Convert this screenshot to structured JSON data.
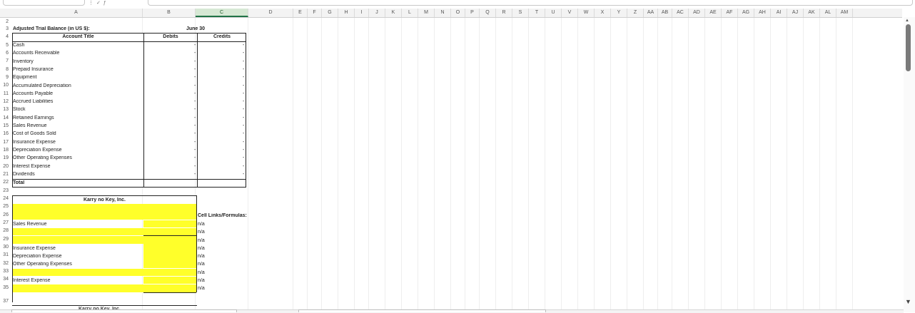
{
  "columns": [
    "A",
    "B",
    "C",
    "D",
    "E",
    "F",
    "G",
    "H",
    "I",
    "J",
    "K",
    "L",
    "M",
    "N",
    "O",
    "P",
    "Q",
    "R",
    "S",
    "T",
    "U",
    "V",
    "W",
    "X",
    "Y",
    "Z",
    "AA",
    "AB",
    "AC",
    "AD",
    "AE",
    "AF",
    "AG",
    "AH",
    "AI",
    "AJ",
    "AK",
    "AL",
    "AM"
  ],
  "selected_column": "C",
  "rows": [
    "2",
    "3",
    "4",
    "5",
    "6",
    "7",
    "8",
    "9",
    "10",
    "11",
    "12",
    "13",
    "14",
    "15",
    "16",
    "17",
    "18",
    "19",
    "20",
    "21",
    "22",
    "23",
    "24",
    "25",
    "26",
    "27",
    "28",
    "29",
    "30",
    "31",
    "32",
    "33",
    "34",
    "35",
    "37"
  ],
  "trial_balance": {
    "title": "Adjusted Trial Balance (in US $):",
    "date": "June 30",
    "header_account": "Account Title",
    "header_debits": "Debits",
    "header_credits": "Credits",
    "accounts": [
      "Cash",
      "Accounts Receivable",
      "Inventory",
      "Prepaid Insurance",
      "Equipment",
      "Accumulated Depreciation",
      "Accounts Payable",
      "Accrued Liabilities",
      "Stock",
      "Retained Earnings",
      "Sales Revenue",
      "Cost of Goods Sold",
      "Insurance Expense",
      "Depreciation Expense",
      "Other Operating Expenses",
      "Interest Expense",
      "Dividends"
    ],
    "dash": "-",
    "total_label": "Total"
  },
  "income_statement": {
    "company": "Karry no Key, Inc.",
    "cell_links_label": "Cell Links/Formulas:",
    "lines": {
      "sales_revenue": "Sales Revenue",
      "insurance_expense": "Insurance Expense",
      "depreciation_expense": "Depreciation Expense",
      "other_operating_expenses": "Other Operating Expenses",
      "interest_expense": "Interest Expense"
    },
    "na": "n/a"
  },
  "next_company_partial": "Karry no Key, Inc.",
  "colors": {
    "highlight": "#ffff2a",
    "selected_header": "#d6e8d4",
    "excel_green": "#217346"
  }
}
